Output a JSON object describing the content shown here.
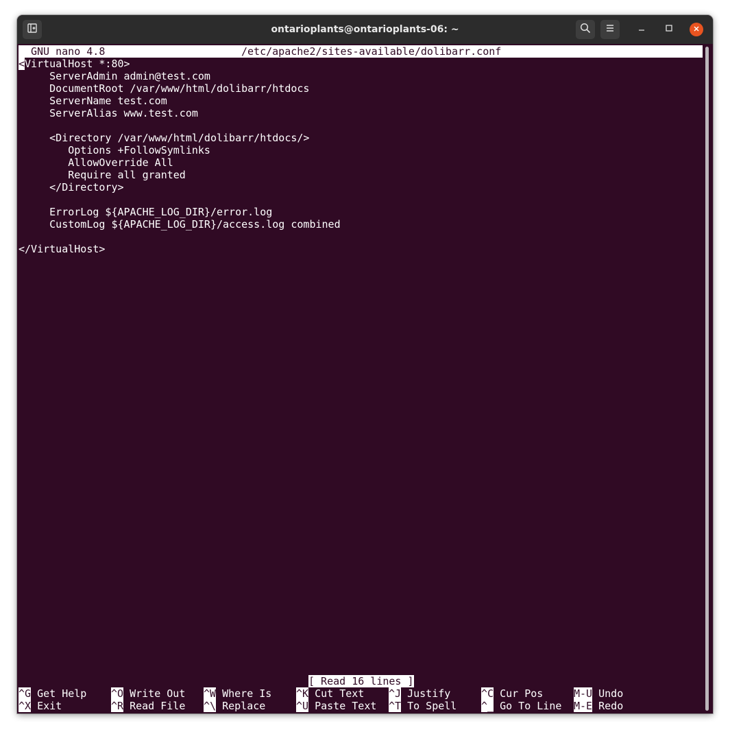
{
  "window": {
    "title": "ontarioplants@ontarioplants-06: ~"
  },
  "icons": {
    "new_tab": "new-tab-icon",
    "search": "search-icon",
    "menu": "hamburger-menu-icon",
    "minimize": "minimize-icon",
    "maximize": "maximize-icon",
    "close": "close-icon"
  },
  "colors": {
    "terminal_bg": "#300a24",
    "titlebar_bg": "#2c2c2c",
    "close_button": "#e95420",
    "text": "#ffffff"
  },
  "nano": {
    "version": "GNU nano 4.8",
    "filename": "/etc/apache2/sites-available/dolibarr.conf",
    "cursor_char": "<",
    "first_line_rest": "VirtualHost *:80>",
    "lines": [
      "     ServerAdmin admin@test.com",
      "     DocumentRoot /var/www/html/dolibarr/htdocs",
      "     ServerName test.com",
      "     ServerAlias www.test.com",
      "",
      "     <Directory /var/www/html/dolibarr/htdocs/>",
      "        Options +FollowSymlinks",
      "        AllowOverride All",
      "        Require all granted",
      "     </Directory>",
      "",
      "     ErrorLog ${APACHE_LOG_DIR}/error.log",
      "     CustomLog ${APACHE_LOG_DIR}/access.log combined",
      "",
      "</VirtualHost>"
    ],
    "status": "[ Read 16 lines ]",
    "shortcuts_row1": [
      {
        "key": "^G",
        "label": "Get Help"
      },
      {
        "key": "^O",
        "label": "Write Out"
      },
      {
        "key": "^W",
        "label": "Where Is"
      },
      {
        "key": "^K",
        "label": "Cut Text"
      },
      {
        "key": "^J",
        "label": "Justify"
      },
      {
        "key": "^C",
        "label": "Cur Pos"
      },
      {
        "key": "M-U",
        "label": "Undo"
      }
    ],
    "shortcuts_row2": [
      {
        "key": "^X",
        "label": "Exit"
      },
      {
        "key": "^R",
        "label": "Read File"
      },
      {
        "key": "^\\",
        "label": "Replace"
      },
      {
        "key": "^U",
        "label": "Paste Text"
      },
      {
        "key": "^T",
        "label": "To Spell"
      },
      {
        "key": "^_",
        "label": "Go To Line"
      },
      {
        "key": "M-E",
        "label": "Redo"
      }
    ]
  }
}
